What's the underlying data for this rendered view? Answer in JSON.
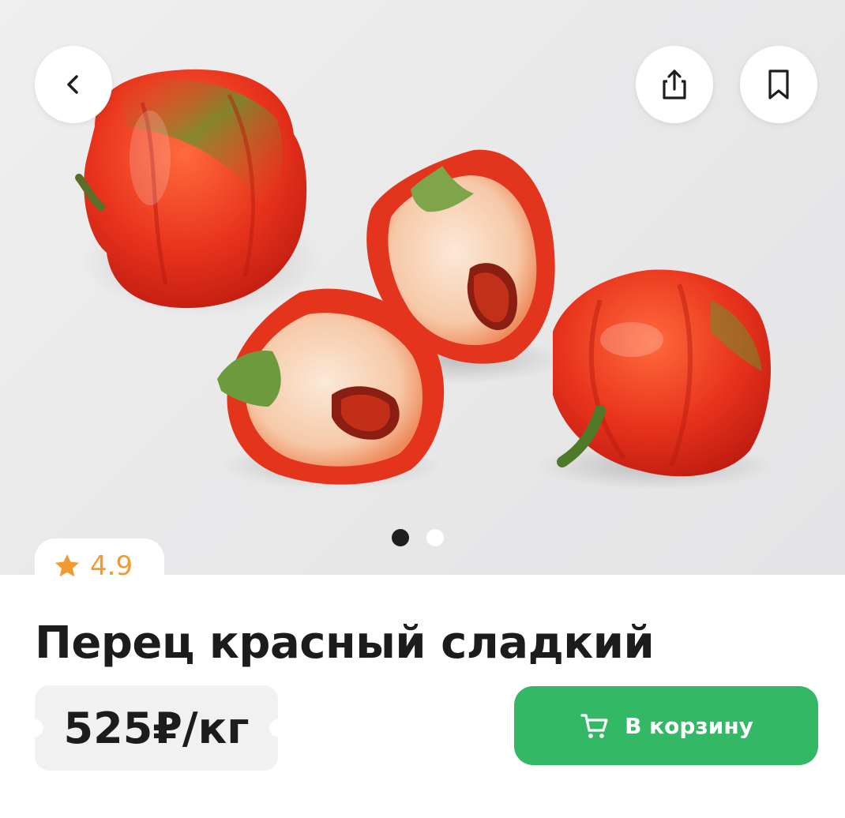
{
  "product": {
    "rating": "4.9",
    "title": "Перец красный сладкий",
    "price": "525₽/кг"
  },
  "actions": {
    "add_to_cart_label": "В корзину"
  },
  "gallery": {
    "image_count": 2,
    "active_index": 0
  },
  "colors": {
    "accent_green": "#33b865",
    "rating_orange": "#f19a2f",
    "text_dark": "#1c1c1c"
  },
  "icons": {
    "back": "chevron-left-icon",
    "share": "share-icon",
    "bookmark": "bookmark-icon",
    "rating": "star-icon",
    "cart": "cart-icon"
  }
}
